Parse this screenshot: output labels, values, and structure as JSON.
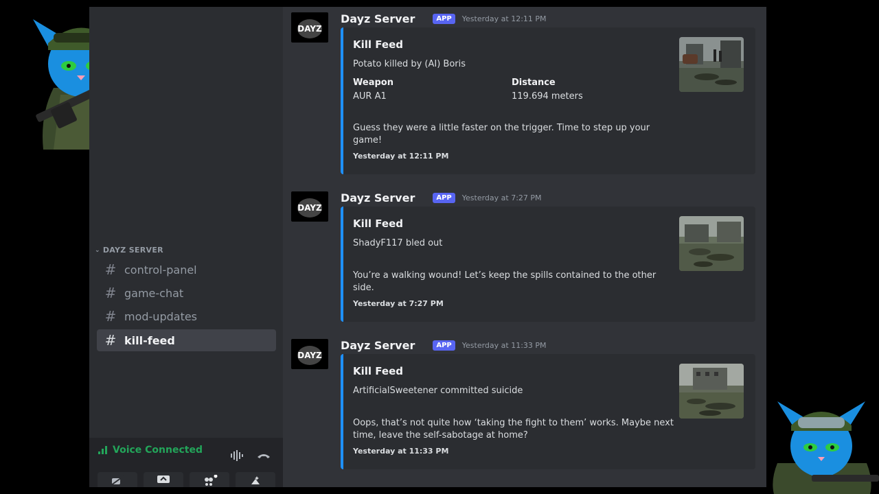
{
  "sidebar": {
    "category": "DAYZ SERVER",
    "channels": [
      {
        "name": "control-panel",
        "active": false
      },
      {
        "name": "game-chat",
        "active": false
      },
      {
        "name": "mod-updates",
        "active": false
      },
      {
        "name": "kill-feed",
        "active": true
      }
    ],
    "voice": {
      "status": "Voice Connected",
      "icons": [
        "signal-icon",
        "soundboard-icon",
        "disconnect-icon"
      ],
      "bottom_icons": [
        "camera-off-icon",
        "screen-share-icon",
        "activities-icon",
        "soundboard-sparkle-icon"
      ]
    }
  },
  "messages": [
    {
      "author": "Dayz Server",
      "avatar_text": "DAYZ",
      "badge": "APP",
      "timestamp": "Yesterday at 12:11 PM",
      "embed": {
        "title": "Kill Feed",
        "description": "Potato killed by (AI) Boris",
        "fields": [
          {
            "name": "Weapon",
            "value": "AUR A1"
          },
          {
            "name": "Distance",
            "value": "119.694 meters"
          }
        ],
        "quote": "Guess they were a little faster on the trigger. Time to step up your game!",
        "footer": "Yesterday at 12:11 PM"
      }
    },
    {
      "author": "Dayz Server",
      "avatar_text": "DAYZ",
      "badge": "APP",
      "timestamp": "Yesterday at 7:27 PM",
      "embed": {
        "title": "Kill Feed",
        "description": "ShadyF117 bled out",
        "quote": "You’re a walking wound! Let’s keep the spills contained to the other side.",
        "footer": "Yesterday at 7:27 PM"
      }
    },
    {
      "author": "Dayz Server",
      "avatar_text": "DAYZ",
      "badge": "APP",
      "timestamp": "Yesterday at 11:33 PM",
      "embed": {
        "title": "Kill Feed",
        "description": "ArtificialSweetener committed suicide",
        "quote": "Oops, that’s not quite how ‘taking the fight to them’ works. Maybe next time, leave the self-sabotage at home?",
        "footer": "Yesterday at 11:33 PM"
      }
    }
  ],
  "colors": {
    "embed_accent": "#1e90ff",
    "badge": "#5865f2",
    "voice_connected": "#23a55a",
    "sidebar_bg": "#2b2d31",
    "chat_bg": "#313338"
  }
}
